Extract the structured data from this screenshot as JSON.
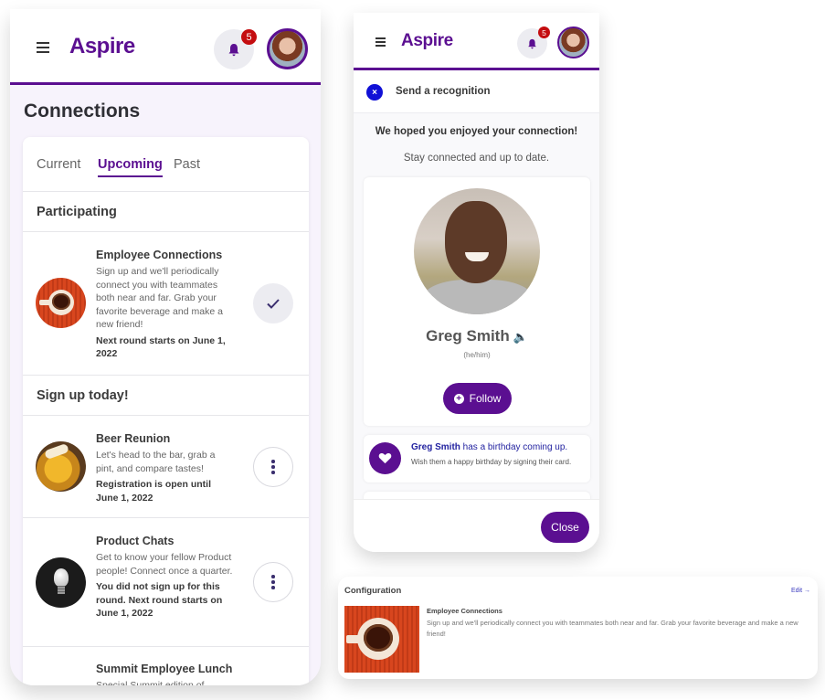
{
  "colors": {
    "brand": "#5b0f91",
    "badge": "#c40d10",
    "recognition_close": "#1010d6"
  },
  "app": {
    "logo": "Aspire",
    "notification_count": "5"
  },
  "connections": {
    "page_title": "Connections",
    "tabs": [
      {
        "label": "Current",
        "active": false
      },
      {
        "label": "Upcoming",
        "active": true
      },
      {
        "label": "Past",
        "active": false
      }
    ],
    "participating": {
      "heading": "Participating",
      "items": [
        {
          "title": "Employee Connections",
          "description": "Sign up and we'll periodically connect you with teammates both near and far. Grab your favorite beverage and make a new friend!",
          "note": "Next round starts on June 1, 2022",
          "action_icon": "check-icon",
          "image": "coffee-cup"
        }
      ]
    },
    "signup": {
      "heading": "Sign up today!",
      "items": [
        {
          "title": "Beer Reunion",
          "description": "Let's head to the bar, grab a pint, and compare tastes!",
          "note": "Registration is open until June 1, 2022",
          "action_icon": "more-vertical-icon",
          "image": "beer-glass"
        },
        {
          "title": "Product Chats",
          "description": "Get to know your fellow Product people! Connect once a quarter.",
          "note": "You did not sign up for this round. Next round starts on June 1, 2022",
          "action_icon": "more-vertical-icon",
          "image": "light-bulb"
        },
        {
          "title": "Summit Employee Lunch",
          "description": "Special Summit edition of",
          "image": "lunch"
        }
      ]
    }
  },
  "recognition": {
    "header_label": "Send a recognition",
    "close_glyph": "×",
    "heading": "We hoped you enjoyed your connection!",
    "subheading": "Stay connected and up to date.",
    "profile": {
      "name": "Greg Smith",
      "pronouns": "(he/him)",
      "speaker_glyph": "🔈",
      "follow_label": "Follow",
      "follow_icon_glyph": "+"
    },
    "birthday": {
      "name": "Greg Smith",
      "title_suffix": " has a birthday coming up.",
      "description": "Wish them a happy birthday by signing their card."
    },
    "close_label": "Close"
  },
  "configuration": {
    "heading": "Configuration",
    "edit_label": "Edit →",
    "title": "Employee Connections",
    "description": "Sign up and we'll periodically connect you with teammates both near and far. Grab your favorite beverage and make a new friend!"
  }
}
